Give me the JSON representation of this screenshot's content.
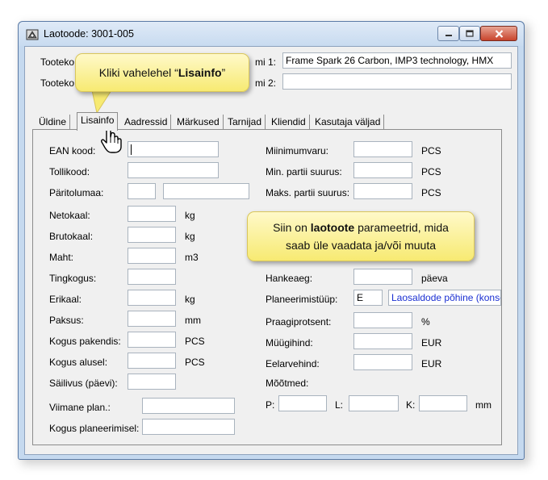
{
  "window": {
    "title": "Laotoode: 3001-005",
    "controls": {
      "minimize": "minimize",
      "maximize": "maximize",
      "close": "close"
    }
  },
  "header": {
    "name1_label_left": "Tooteko",
    "name1_label_right": "mi 1:",
    "name1_value": "Frame Spark 26 Carbon, IMP3 technology, HMX",
    "name2_label_left": "Tooteko",
    "name2_label_right": "mi 2:",
    "name2_value": ""
  },
  "tabs": [
    {
      "label": "Üldine",
      "active": false
    },
    {
      "label": "Lisainfo",
      "active": true
    },
    {
      "label": "Aadressid",
      "active": false
    },
    {
      "label": "Märkused",
      "active": false
    },
    {
      "label": "Tarnijad",
      "active": false
    },
    {
      "label": "Kliendid",
      "active": false
    },
    {
      "label": "Kasutaja väljad",
      "active": false
    }
  ],
  "left_fields": {
    "ean": {
      "label": "EAN kood:",
      "value": ""
    },
    "tollikood": {
      "label": "Tollikood:",
      "value": ""
    },
    "paritolumaa": {
      "label": "Päritolumaa:",
      "value": ""
    },
    "netokaal": {
      "label": "Netokaal:",
      "value": "",
      "unit": "kg"
    },
    "brutokaal": {
      "label": "Brutokaal:",
      "value": "",
      "unit": "kg"
    },
    "maht": {
      "label": "Maht:",
      "value": "",
      "unit": "m3"
    },
    "tingkogus": {
      "label": "Tingkogus:",
      "value": ""
    },
    "erikaal": {
      "label": "Erikaal:",
      "value": "",
      "unit": "kg"
    },
    "paksus": {
      "label": "Paksus:",
      "value": "",
      "unit": "mm"
    },
    "kogus_pakendis": {
      "label": "Kogus pakendis:",
      "value": "",
      "unit": "PCS"
    },
    "kogus_alusel": {
      "label": "Kogus alusel:",
      "value": "",
      "unit": "PCS"
    },
    "sailivus": {
      "label": "Säilivus (päevi):",
      "value": ""
    },
    "viimane_plan": {
      "label": "Viimane plan.:",
      "value": ""
    },
    "kogus_planeerimisel": {
      "label": "Kogus planeerimisel:",
      "value": ""
    }
  },
  "right_fields": {
    "miinimumvaru": {
      "label": "Miinimumvaru:",
      "value": "",
      "unit": "PCS"
    },
    "min_partii": {
      "label": "Min. partii suurus:",
      "value": "",
      "unit": "PCS"
    },
    "maks_partii": {
      "label": "Maks. partii suurus:",
      "value": "",
      "unit": "PCS"
    },
    "hankeaeg": {
      "label": "Hankeaeg:",
      "value": "",
      "unit": "päeva"
    },
    "planeerimistuup": {
      "label": "Planeerimistüüp:",
      "code": "E",
      "description": "Laosaldode põhine (konse"
    },
    "praagiprotsent": {
      "label": "Praagiprotsent:",
      "value": "",
      "unit": "%"
    },
    "muugihind": {
      "label": "Müügihind:",
      "value": "",
      "unit": "EUR"
    },
    "eelarvehind": {
      "label": "Eelarvehind:",
      "value": "",
      "unit": "EUR"
    },
    "mootmed": {
      "label": "Mõõtmed:",
      "p_label": "P:",
      "p_value": "",
      "l_label": "L:",
      "l_value": "",
      "k_label": "K:",
      "k_value": "",
      "unit": "mm"
    }
  },
  "callouts": {
    "tab_hint": {
      "before": "Kliki vahelehel “",
      "bold": "Lisainfo",
      "after": "”"
    },
    "params_hint": {
      "line1_before": "Siin on ",
      "line1_bold": "laotoote",
      "line1_after": " parameetrid, mida",
      "line2": "saab üle vaadata ja/või muuta"
    }
  },
  "colors": {
    "callout_fill": "#f7ea72",
    "window_frame": "#c5d9ef",
    "close_button": "#c8442c",
    "link_text": "#1a2fd2"
  }
}
